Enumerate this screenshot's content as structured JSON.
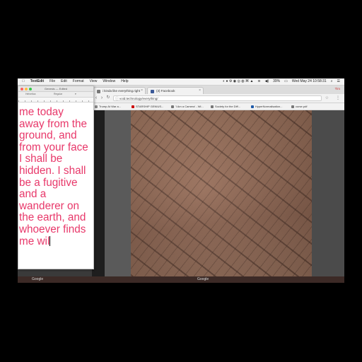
{
  "menubar": {
    "apple": "",
    "app_name": "TextEdit",
    "items": [
      "File",
      "Edit",
      "Format",
      "View",
      "Window",
      "Help"
    ],
    "status_text": "Wed May 24  10:58:31",
    "battery": "39%"
  },
  "textedit": {
    "title": "Genesis — Edited",
    "toolbar_font": "Helvetica",
    "toolbar_style": "Regular",
    "lines": [
      "me today",
      "away from the",
      "ground, and",
      "from your face",
      "I shall be",
      "hidden. I shall",
      "be a fugitive",
      "and a",
      "wanderer on",
      "the earth, and",
      "whoever finds",
      "me wil"
    ],
    "text_color": "#e8386a"
  },
  "browser": {
    "tabs": [
      {
        "label": "i kinda like everything.right",
        "icon_color": "#777777"
      },
      {
        "label": "(3) Facebook",
        "icon_color": "#3b5998"
      }
    ],
    "user": "Tim",
    "url": "void.technology/everything/",
    "bookmarks": [
      {
        "label": "Trump At War a...",
        "color": "#888888"
      },
      {
        "label": "STARSHIP GENIUS...",
        "color": "#cc0000"
      },
      {
        "label": "'I Am a Camera' - Wi...",
        "color": "#777777"
      },
      {
        "label": "Society for the Diff...",
        "color": "#777777"
      },
      {
        "label": "HyperNormalisation...",
        "color": "#1e5aa8"
      },
      {
        "label": "curse.pdf",
        "color": "#777777"
      }
    ]
  },
  "taskbar": {
    "left_label": "Google",
    "right_label": "Google"
  }
}
